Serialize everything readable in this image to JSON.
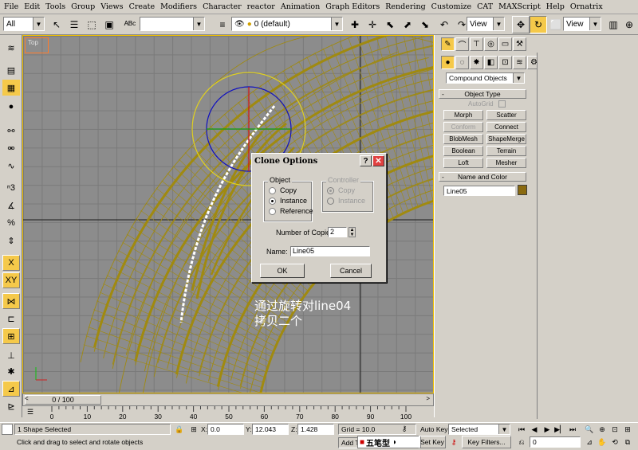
{
  "menu": [
    "File",
    "Edit",
    "Tools",
    "Group",
    "Views",
    "Create",
    "Modifiers",
    "Character",
    "reactor",
    "Animation",
    "Graph Editors",
    "Rendering",
    "Customize",
    "CAT",
    "MAXScript",
    "Help",
    "Ornatrix"
  ],
  "toolbar": {
    "selection_filter": "All",
    "named_selection": "",
    "layer": "0 (default)",
    "view_combo_1": "View",
    "view_combo_2": "View"
  },
  "viewport": {
    "label": "Top",
    "annotation_line1": "通过旋转对line04",
    "annotation_line2": "拷贝二个",
    "wire_color": "#a08a10"
  },
  "dialog": {
    "title": "Clone Options",
    "help_label": "?",
    "close_label": "✕",
    "object_group": "Object",
    "controller_group": "Controller",
    "object_options": [
      {
        "label": "Copy",
        "selected": false
      },
      {
        "label": "Instance",
        "selected": true
      },
      {
        "label": "Reference",
        "selected": false
      }
    ],
    "controller_options": [
      {
        "label": "Copy",
        "selected": true
      },
      {
        "label": "Instance",
        "selected": false
      }
    ],
    "copies_label": "Number of Copies:",
    "copies_value": "2",
    "name_label": "Name:",
    "name_value": "Line05",
    "ok_label": "OK",
    "cancel_label": "Cancel"
  },
  "command_panel": {
    "category_dropdown": "Compound Objects",
    "object_type_header": "Object Type",
    "autogrid_label": "AutoGrid",
    "buttons": [
      {
        "label": "Morph",
        "enabled": true
      },
      {
        "label": "Scatter",
        "enabled": true
      },
      {
        "label": "Conform",
        "enabled": false
      },
      {
        "label": "Connect",
        "enabled": true
      },
      {
        "label": "BlobMesh",
        "enabled": true
      },
      {
        "label": "ShapeMerge",
        "enabled": true
      },
      {
        "label": "Boolean",
        "enabled": true
      },
      {
        "label": "Terrain",
        "enabled": true
      },
      {
        "label": "Loft",
        "enabled": true
      },
      {
        "label": "Mesher",
        "enabled": true
      }
    ],
    "name_color_header": "Name and Color",
    "object_name": "Line05",
    "object_color": "#8a6a10",
    "header_sign": "-"
  },
  "timeline": {
    "slider_label": "0 / 100",
    "ticks": [
      "0",
      "10",
      "20",
      "30",
      "40",
      "50",
      "60",
      "70",
      "80",
      "90",
      "100"
    ]
  },
  "status": {
    "selection": "1 Shape Selected",
    "prompt": "Click and drag to select and rotate objects",
    "x_label": "X:",
    "x_value": "0.0",
    "y_label": "Y:",
    "y_value": "12.043",
    "z_label": "Z:",
    "z_value": "1.428",
    "grid": "Grid = 10.0",
    "add_time_tag": "Add T",
    "auto_key": "Auto Key",
    "selected_dropdown": "Selected",
    "set_key": "Set Key",
    "key_filters": "Key Filters...",
    "frame": "0",
    "ime_text": "五笔型"
  }
}
